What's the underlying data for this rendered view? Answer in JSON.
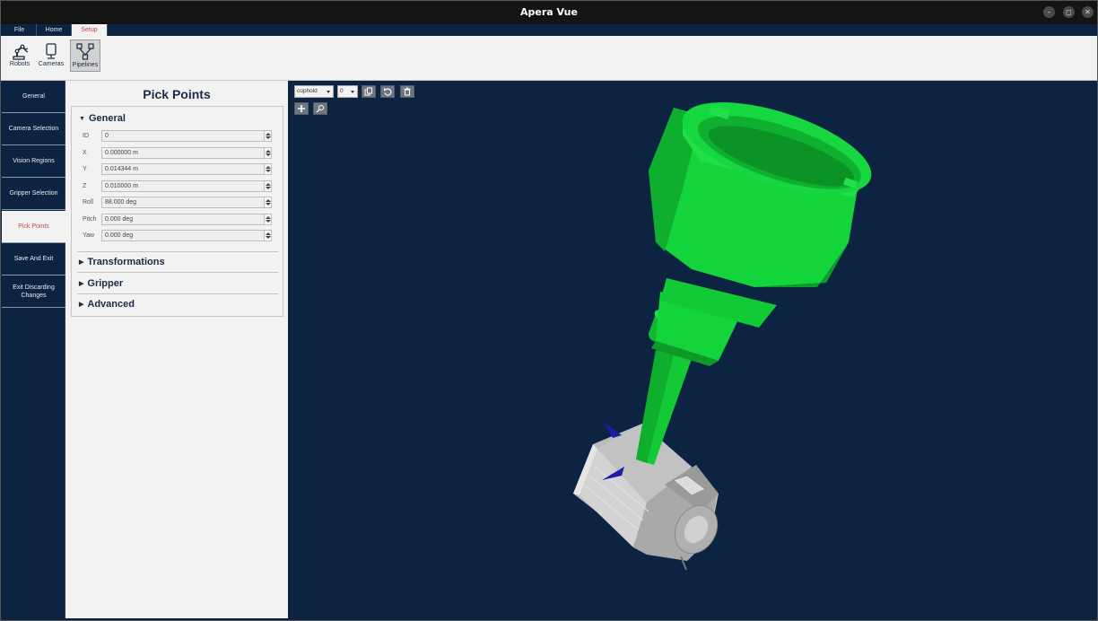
{
  "window": {
    "title": "Apera Vue"
  },
  "menu": {
    "tabs": [
      "File",
      "Home",
      "Setup"
    ],
    "active": "Setup"
  },
  "ribbon": {
    "buttons": [
      "Robots",
      "Cameras",
      "Pipelines"
    ],
    "active": "Pipelines"
  },
  "sidebar": {
    "items": [
      "General",
      "Camera Selection",
      "Vision Regions",
      "Gripper Selection",
      "Pick Points",
      "Save And Exit",
      "Exit Discarding Changes"
    ],
    "active": "Pick Points"
  },
  "panel": {
    "title": "Pick Points",
    "general": {
      "label": "General",
      "fields": [
        {
          "label": "ID",
          "value": "0"
        },
        {
          "label": "X",
          "value": "0.000000 m"
        },
        {
          "label": "Y",
          "value": "0.014344 m"
        },
        {
          "label": "Z",
          "value": "0.010000 m"
        },
        {
          "label": "Roll",
          "value": "88.000 deg"
        },
        {
          "label": "Pitch",
          "value": "0.000 deg"
        },
        {
          "label": "Yaw",
          "value": "0.000 deg"
        }
      ]
    },
    "sections": [
      "Transformations",
      "Gripper",
      "Advanced"
    ]
  },
  "viewport": {
    "object_select": "cophold",
    "index_select": "0",
    "tool_icons": [
      "copy-icon",
      "undo-icon",
      "trash-icon",
      "add-icon",
      "pick-point-icon"
    ]
  },
  "colors": {
    "navy": "#0c2341",
    "gripper_green": "#14d43c",
    "part_gray": "#c8c8c8",
    "active_red": "#d04040"
  }
}
